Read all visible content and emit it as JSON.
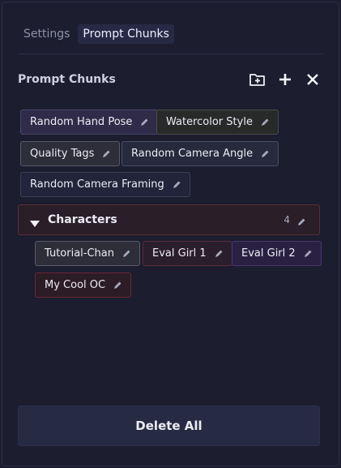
{
  "tabs": [
    {
      "label": "Settings",
      "active": false
    },
    {
      "label": "Prompt Chunks",
      "active": true
    }
  ],
  "section": {
    "title": "Prompt Chunks",
    "tools": [
      "folder-plus-icon",
      "plus-icon",
      "close-icon"
    ]
  },
  "chunks": [
    {
      "label": "Random Hand Pose",
      "color": "#2f2b48"
    },
    {
      "label": "Watercolor Style",
      "color": "#282a2a"
    },
    {
      "label": "Quality Tags",
      "color": "#2d2e3a"
    },
    {
      "label": "Random Camera Angle",
      "color": "#272a3d"
    },
    {
      "label": "Random Camera Framing",
      "color": "#21243a"
    }
  ],
  "group": {
    "name": "Characters",
    "count": "4",
    "expanded": true,
    "items": [
      {
        "label": "Tutorial-Chan",
        "color": "#2d2e3a"
      },
      {
        "label": "Eval Girl 1",
        "color": "#2a1e2a"
      },
      {
        "label": "Eval Girl 2",
        "color": "#2a2142"
      },
      {
        "label": "My Cool OC",
        "color": "#2c1c26"
      }
    ]
  },
  "delete_all_label": "Delete All"
}
